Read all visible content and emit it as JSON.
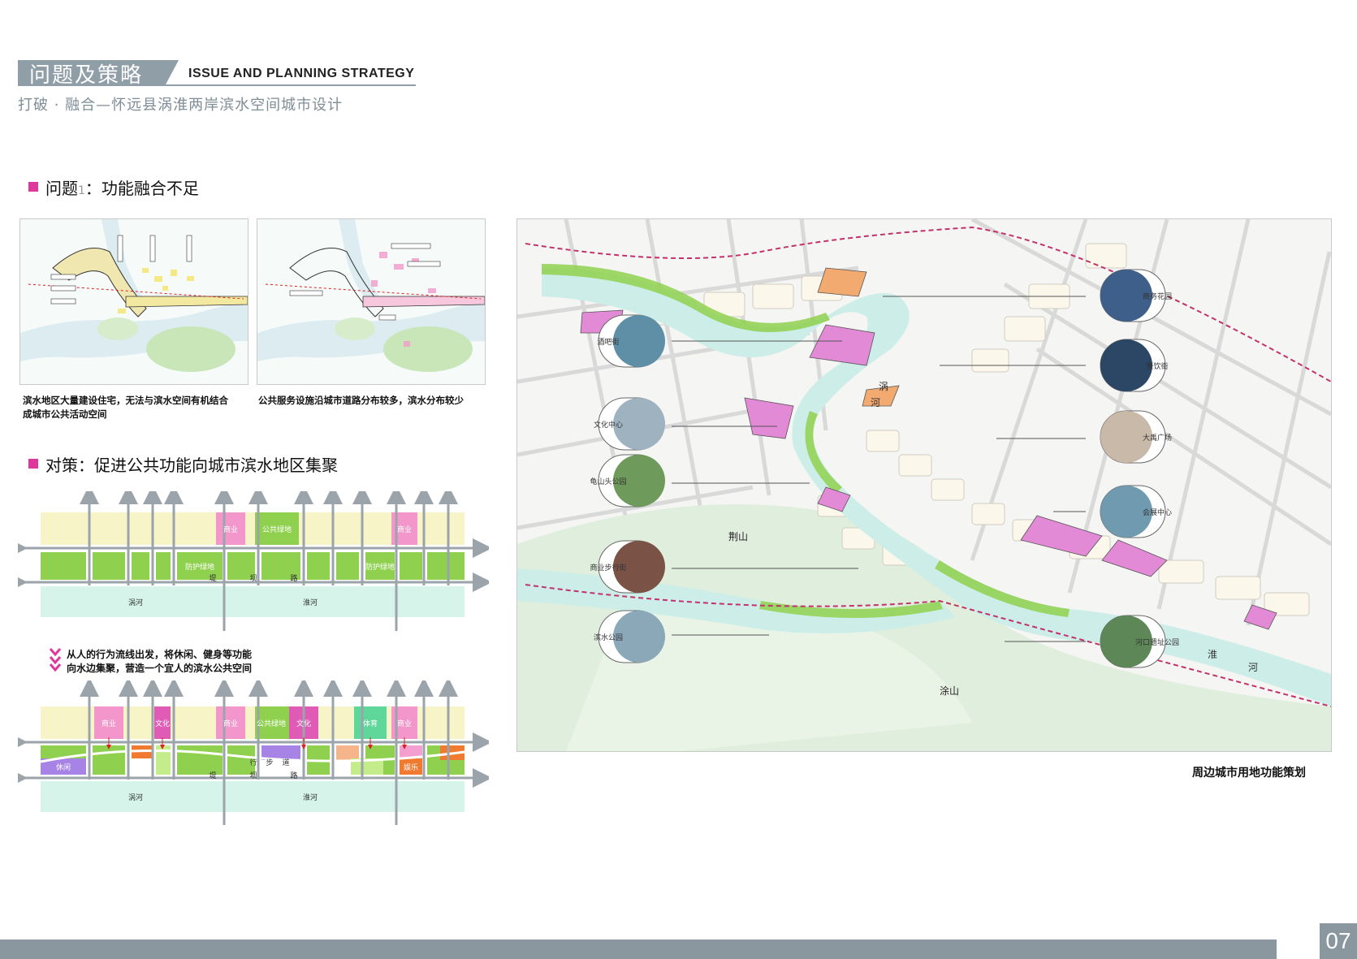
{
  "header": {
    "title_cn": "问题及策略",
    "title_en": "ISSUE AND PLANNING STRATEGY",
    "subtitle": "打破 · 融合—怀远县涡淮两岸滨水空间城市设计"
  },
  "problem": {
    "heading": "问题",
    "heading_rest": "：功能融合不足",
    "caption_left": "滨水地区大量建设住宅，无法与滨水空间有机结合成城市公共活动空间",
    "caption_right": "公共服务设施沿城市道路分布较多，滨水分布较少"
  },
  "strategy": {
    "heading": "对策：促进公共功能向城市滨水地区集聚",
    "note_line1": "从人的行为流线出发，将休闲、健身等功能",
    "note_line2": "向水边集聚，营造一个宜人的滨水公共空间"
  },
  "diagram1": {
    "labels": [
      "商业",
      "公共绿地",
      "商业",
      "防护绿地",
      "防护绿地",
      "堤",
      "坝",
      "路",
      "涡河",
      "淮河"
    ]
  },
  "diagram2": {
    "labels": [
      "商业",
      "文化",
      "商业",
      "公共绿地",
      "文化",
      "体育",
      "商业",
      "休闲",
      "娱乐",
      "堤",
      "坝",
      "路",
      "行",
      "步",
      "道",
      "涡河",
      "淮河"
    ]
  },
  "map": {
    "caption": "周边城市用地功能策划",
    "river_labels": [
      "涡",
      "河",
      "淮",
      "河"
    ],
    "mountains": [
      "荆山",
      "涂山"
    ],
    "callouts_left": [
      "酒吧街",
      "文化中心",
      "龟山头公园",
      "商业步行街",
      "滨水公园"
    ],
    "callouts_right": [
      "商务花园",
      "餐饮街",
      "大禹广场",
      "会展中心",
      "河口遗址公园"
    ]
  },
  "colors": {
    "accent_pink": "#e0389a",
    "header_gray": "#8f9ea7",
    "residential": "#f7f4c8",
    "green": "#8fd14f",
    "river": "#cdeee8",
    "commerce": "#e38ad6",
    "orange": "#f0a060"
  },
  "page_number": "07"
}
